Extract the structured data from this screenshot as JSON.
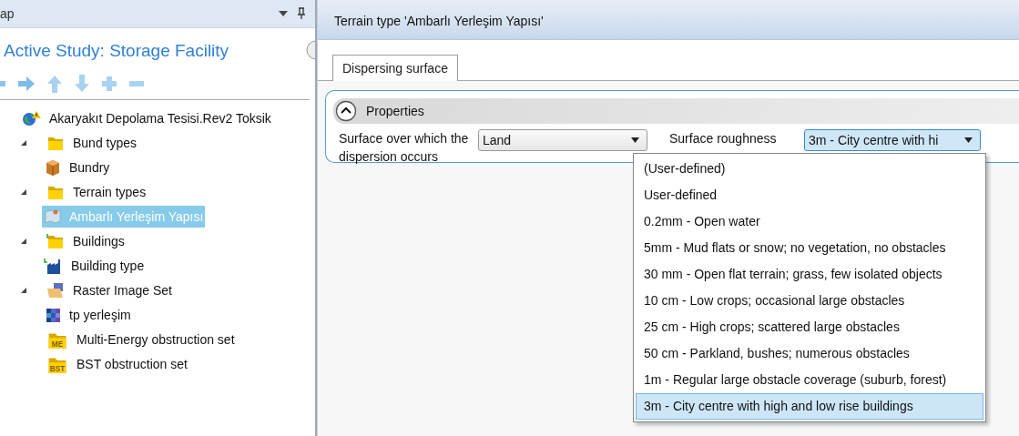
{
  "left_pane": {
    "title": "ap",
    "heading": "Active Study: Storage Facility"
  },
  "tree": [
    {
      "label": "Akaryakıt Depolama Tesisi.Rev2 Toksik",
      "kind": "globe",
      "warning": true,
      "selected": false,
      "children": [
        {
          "label": "Bund types",
          "kind": "folder",
          "expanded": true,
          "selected": false,
          "children": [
            {
              "label": "Bundry",
              "kind": "box",
              "selected": false
            }
          ]
        },
        {
          "label": "Terrain types",
          "kind": "folder",
          "expanded": true,
          "selected": false,
          "children": [
            {
              "label": "Ambarlı Yerleşim Yapısı",
              "kind": "map",
              "selected": true
            }
          ]
        },
        {
          "label": "Buildings",
          "kind": "folder",
          "modified": true,
          "expanded": true,
          "selected": false,
          "children": [
            {
              "label": "Building type",
              "kind": "factory",
              "modified": true,
              "selected": false
            }
          ]
        },
        {
          "label": "Raster Image Set",
          "kind": "image_folder",
          "expanded": true,
          "selected": false,
          "children": [
            {
              "label": "tp yerleşim",
              "kind": "grid",
              "selected": false
            }
          ]
        },
        {
          "label": "Multi-Energy obstruction set",
          "kind": "tag_folder",
          "badge": "ME",
          "selected": false
        },
        {
          "label": "BST obstruction set",
          "kind": "tag_folder",
          "badge": "BST",
          "selected": false
        }
      ]
    }
  ],
  "editor": {
    "title": "Terrain type 'Ambarlı Yerleşim Yapısı'",
    "tabs": [
      {
        "label": "Dispersing surface",
        "selected": true
      }
    ],
    "group": {
      "title": "Properties",
      "expanded": true
    },
    "fields": [
      {
        "label": "Surface over which the dispersion occurs",
        "value": "Land",
        "open": false
      },
      {
        "label": "Surface roughness",
        "value": "3m - City centre with hi",
        "open": true,
        "options": [
          {
            "label": "(User-defined)",
            "selected": false
          },
          {
            "label": "User-defined",
            "selected": false
          },
          {
            "label": "0.2mm - Open water",
            "selected": false
          },
          {
            "label": "5mm - Mud flats or snow; no vegetation, no obstacles",
            "selected": false
          },
          {
            "label": "30 mm - Open flat terrain; grass, few isolated objects",
            "selected": false
          },
          {
            "label": "10 cm - Low crops; occasional large obstacles",
            "selected": false
          },
          {
            "label": "25 cm - High crops; scattered large obstacles",
            "selected": false
          },
          {
            "label": "50 cm - Parkland, bushes; numerous obstacles",
            "selected": false
          },
          {
            "label": "1m - Regular large obstacle coverage (suburb, forest)",
            "selected": false
          },
          {
            "label": "3m - City centre with high and low rise buildings",
            "selected": true
          }
        ]
      }
    ]
  }
}
